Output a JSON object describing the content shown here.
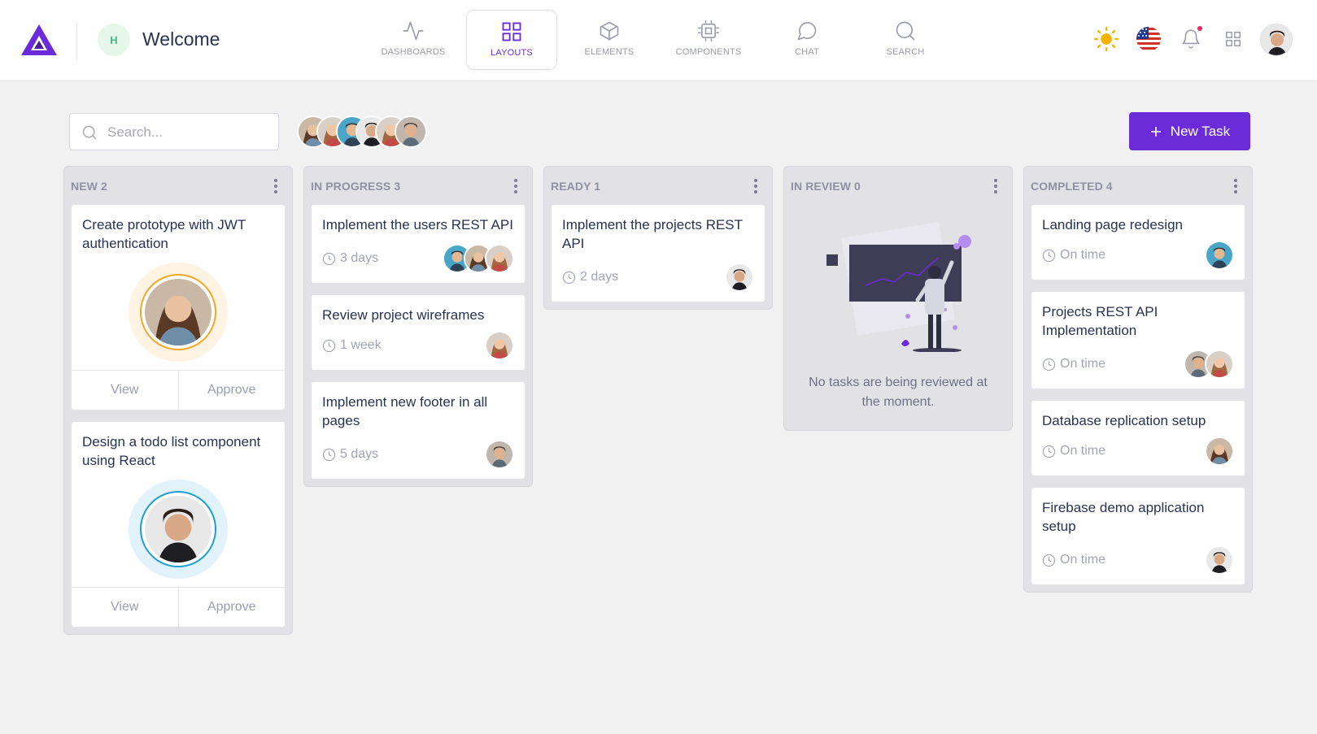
{
  "header": {
    "avatar_initial": "H",
    "title": "Welcome",
    "nav": [
      {
        "label": "Dashboards",
        "icon": "activity-icon"
      },
      {
        "label": "Layouts",
        "icon": "grid-icon",
        "active": true
      },
      {
        "label": "Elements",
        "icon": "box-icon"
      },
      {
        "label": "Components",
        "icon": "cpu-icon"
      },
      {
        "label": "Chat",
        "icon": "message-circle-icon"
      },
      {
        "label": "Search",
        "icon": "search-icon"
      }
    ],
    "right_icons": [
      "sun-icon",
      "us-flag-icon",
      "bell-icon",
      "apps-grid-icon",
      "user-avatar"
    ]
  },
  "toolbar": {
    "search_placeholder": "Search...",
    "new_task_label": "New Task"
  },
  "colors": {
    "accent": "#6c2bd9",
    "page_bg": "#f1f1f1",
    "column_bg": "#e2e2e6"
  },
  "columns": [
    {
      "title": "NEW 2",
      "cards": [
        {
          "title": "Create prototype with JWT authentication",
          "view": "View",
          "approve": "Approve"
        },
        {
          "title": "Design a todo list component using React",
          "view": "View",
          "approve": "Approve"
        }
      ]
    },
    {
      "title": "IN PROGRESS 3",
      "cards": [
        {
          "title": "Implement the users REST API",
          "meta": "3 days"
        },
        {
          "title": "Review project wireframes",
          "meta": "1 week"
        },
        {
          "title": "Implement new footer in all pages",
          "meta": "5 days"
        }
      ]
    },
    {
      "title": "READY 1",
      "cards": [
        {
          "title": "Implement the projects REST API",
          "meta": "2 days"
        }
      ]
    },
    {
      "title": "IN REVIEW 0",
      "empty_text": "No tasks are being reviewed at the moment."
    },
    {
      "title": "COMPLETED 4",
      "cards": [
        {
          "title": "Landing page redesign",
          "meta": "On time"
        },
        {
          "title": "Projects REST API Implementation",
          "meta": "On time"
        },
        {
          "title": "Database replication setup",
          "meta": "On time"
        },
        {
          "title": "Firebase demo application setup",
          "meta": "On time"
        }
      ]
    }
  ]
}
